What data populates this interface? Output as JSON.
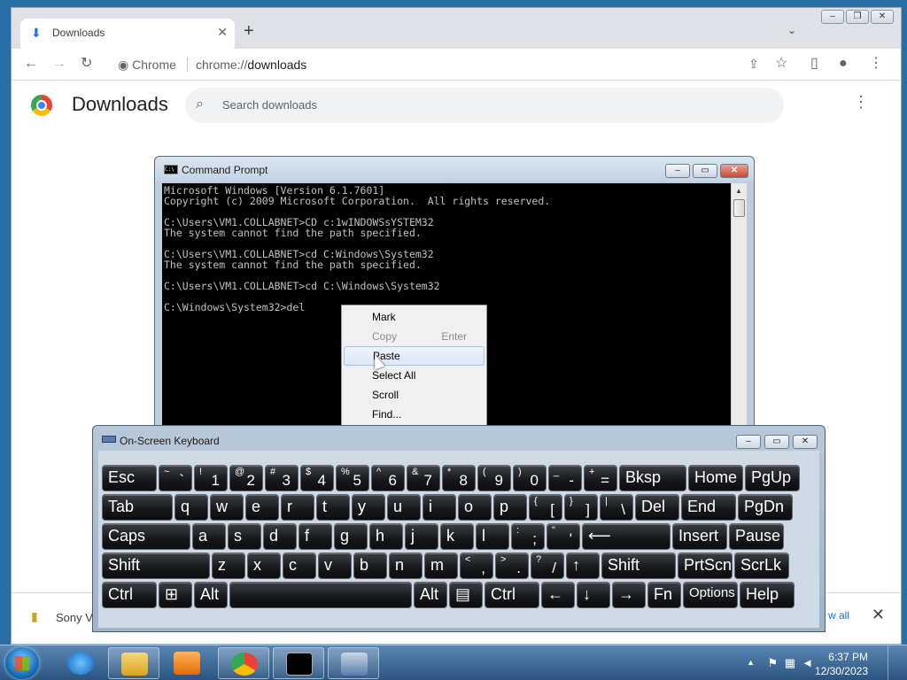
{
  "chrome": {
    "tab_title": "Downloads",
    "tab_close": "✕",
    "new_tab": "+",
    "tab_search": "⌄",
    "omnibox_chip": "Chrome",
    "omnibox_scheme": "chrome://",
    "omnibox_path": "downloads",
    "page_title": "Downloads",
    "search_placeholder": "Search downloads",
    "download_file": "Sony Ve",
    "show_all": "w all"
  },
  "cmd": {
    "title": "Command Prompt",
    "lines": [
      "Microsoft Windows [Version 6.1.7601]",
      "Copyright (c) 2009 Microsoft Corporation.  All rights reserved.",
      "",
      "C:\\Users\\VM1.COLLABNET>CD c:1wINDOWSsYSTEM32",
      "The system cannot find the path specified.",
      "",
      "C:\\Users\\VM1.COLLABNET>cd C:Windows\\System32",
      "The system cannot find the path specified.",
      "",
      "C:\\Users\\VM1.COLLABNET>cd C:\\Windows\\System32",
      "",
      "C:\\Windows\\System32>del"
    ]
  },
  "context_menu": {
    "items": [
      {
        "label": "Mark",
        "shortcut": "",
        "state": "normal"
      },
      {
        "label": "Copy",
        "shortcut": "Enter",
        "state": "disabled"
      },
      {
        "label": "Paste",
        "shortcut": "",
        "state": "hover"
      },
      {
        "label": "Select All",
        "shortcut": "",
        "state": "normal"
      },
      {
        "label": "Scroll",
        "shortcut": "",
        "state": "normal"
      },
      {
        "label": "Find...",
        "shortcut": "",
        "state": "normal"
      }
    ]
  },
  "osk": {
    "title": "On-Screen Keyboard",
    "rows": [
      [
        {
          "main": "Esc"
        },
        {
          "top": "~",
          "bot": "`"
        },
        {
          "top": "!",
          "bot": "1"
        },
        {
          "top": "@",
          "bot": "2"
        },
        {
          "top": "#",
          "bot": "3"
        },
        {
          "top": "$",
          "bot": "4"
        },
        {
          "top": "%",
          "bot": "5"
        },
        {
          "top": "^",
          "bot": "6"
        },
        {
          "top": "&",
          "bot": "7"
        },
        {
          "top": "*",
          "bot": "8"
        },
        {
          "top": "(",
          "bot": "9"
        },
        {
          "top": ")",
          "bot": "0"
        },
        {
          "top": "_",
          "bot": "-"
        },
        {
          "top": "+",
          "bot": "="
        },
        {
          "main": "Bksp"
        },
        {
          "main": "Home"
        },
        {
          "main": "PgUp"
        }
      ],
      [
        {
          "main": "Tab"
        },
        {
          "main": "q"
        },
        {
          "main": "w"
        },
        {
          "main": "e"
        },
        {
          "main": "r"
        },
        {
          "main": "t"
        },
        {
          "main": "y"
        },
        {
          "main": "u"
        },
        {
          "main": "i"
        },
        {
          "main": "o"
        },
        {
          "main": "p"
        },
        {
          "top": "{",
          "bot": "["
        },
        {
          "top": "}",
          "bot": "]"
        },
        {
          "top": "|",
          "bot": "\\"
        },
        {
          "main": "Del"
        },
        {
          "main": "End"
        },
        {
          "main": "PgDn"
        }
      ],
      [
        {
          "main": "Caps"
        },
        {
          "main": "a"
        },
        {
          "main": "s"
        },
        {
          "main": "d"
        },
        {
          "main": "f"
        },
        {
          "main": "g"
        },
        {
          "main": "h"
        },
        {
          "main": "j"
        },
        {
          "main": "k"
        },
        {
          "main": "l"
        },
        {
          "top": ":",
          "bot": ";"
        },
        {
          "top": "\"",
          "bot": "'"
        },
        {
          "main": "⟵"
        },
        {
          "main": "Insert"
        },
        {
          "main": "Pause"
        }
      ],
      [
        {
          "main": "Shift"
        },
        {
          "main": "z"
        },
        {
          "main": "x"
        },
        {
          "main": "c"
        },
        {
          "main": "v"
        },
        {
          "main": "b"
        },
        {
          "main": "n"
        },
        {
          "main": "m"
        },
        {
          "top": "<",
          "bot": ","
        },
        {
          "top": ">",
          "bot": "."
        },
        {
          "top": "?",
          "bot": "/"
        },
        {
          "main": "↑"
        },
        {
          "main": "Shift"
        },
        {
          "main": "PrtScn"
        },
        {
          "main": "ScrLk"
        }
      ],
      [
        {
          "main": "Ctrl"
        },
        {
          "main": "⊞"
        },
        {
          "main": "Alt"
        },
        {
          "main": ""
        },
        {
          "main": "Alt"
        },
        {
          "main": "▤"
        },
        {
          "main": "Ctrl"
        },
        {
          "main": "←"
        },
        {
          "main": "↓"
        },
        {
          "main": "→"
        },
        {
          "main": "Fn"
        },
        {
          "main": "Options"
        },
        {
          "main": "Help"
        }
      ]
    ]
  },
  "taskbar": {
    "time": "6:37 PM",
    "date": "12/30/2023"
  }
}
